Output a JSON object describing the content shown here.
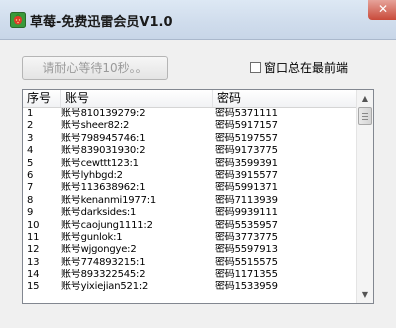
{
  "window": {
    "title": "草莓-免费迅雷会员V1.0",
    "close_glyph": "✕"
  },
  "controls": {
    "wait_button_label": "请耐心等待10秒。。",
    "topmost_checkbox_label": "窗口总在最前端",
    "topmost_checked": false
  },
  "list": {
    "columns": [
      "序号",
      "账号",
      "密码"
    ],
    "rows": [
      {
        "no": "1",
        "account": "账号810139279:2",
        "password": "密码5371111"
      },
      {
        "no": "2",
        "account": "账号sheer82:2",
        "password": "密码5917157"
      },
      {
        "no": "3",
        "account": "账号798945746:1",
        "password": "密码5197557"
      },
      {
        "no": "4",
        "account": "账号839031930:2",
        "password": "密码9173775"
      },
      {
        "no": "5",
        "account": "账号cewttt123:1",
        "password": "密码3599391"
      },
      {
        "no": "6",
        "account": "账号lyhbgd:2",
        "password": "密码3915577"
      },
      {
        "no": "7",
        "account": "账号113638962:1",
        "password": "密码5991371"
      },
      {
        "no": "8",
        "account": "账号kenanmi1977:1",
        "password": "密码7113939"
      },
      {
        "no": "9",
        "account": "账号darksides:1",
        "password": "密码9939111"
      },
      {
        "no": "10",
        "account": "账号caojung1111:2",
        "password": "密码5535957"
      },
      {
        "no": "11",
        "account": "账号gunlok:1",
        "password": "密码3773775"
      },
      {
        "no": "12",
        "account": "账号wjgongye:2",
        "password": "密码5597913"
      },
      {
        "no": "13",
        "account": "账号774893215:1",
        "password": "密码5515575"
      },
      {
        "no": "14",
        "account": "账号893322545:2",
        "password": "密码1171355"
      },
      {
        "no": "15",
        "account": "账号yixiejian521:2",
        "password": "密码1533959"
      }
    ]
  },
  "colors": {
    "title_bar": "#cfdcec",
    "close_button": "#c94a3a",
    "disabled_text": "#9a9a9a"
  },
  "icons": {
    "app": "strawberry-icon",
    "scroll_up": "▲",
    "scroll_down": "▼"
  }
}
